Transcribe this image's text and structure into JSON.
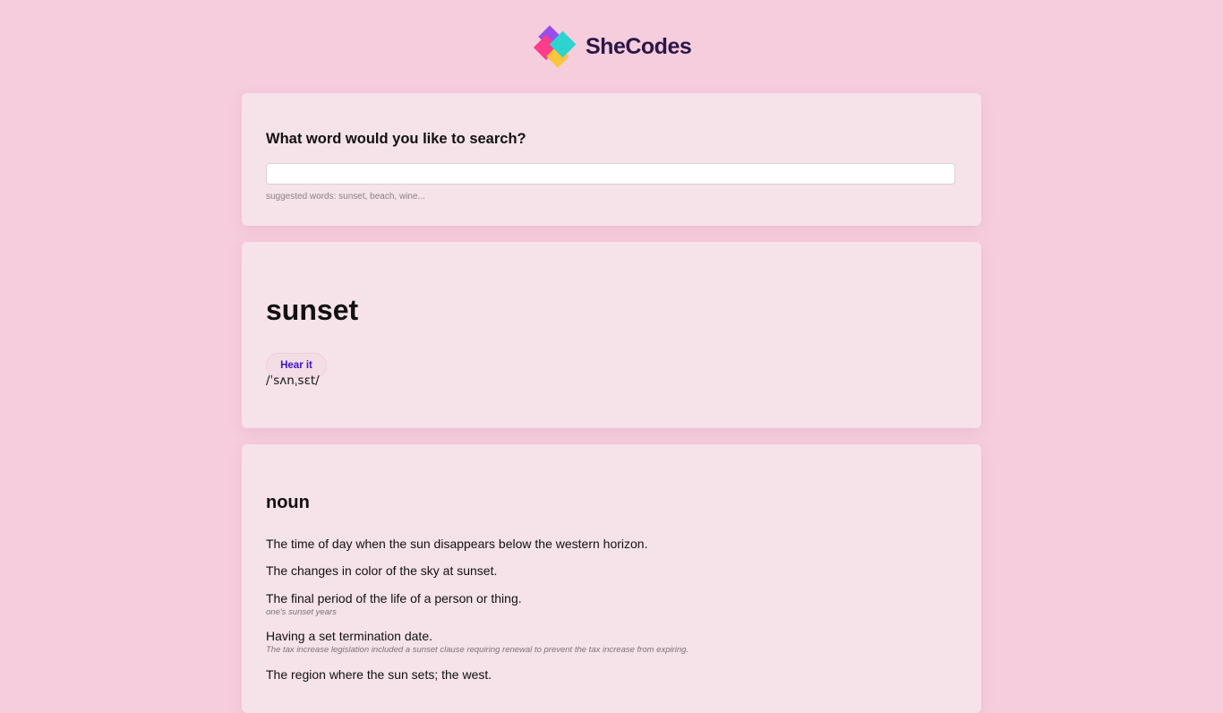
{
  "brand": {
    "name": "SheCodes",
    "logo_colors": [
      "#9b4dea",
      "#ff3d8b",
      "#2ed3d0",
      "#ffc53d"
    ]
  },
  "search": {
    "question": "What word would you like to search?",
    "input_value": "",
    "hint": "suggested words: sunset, beach, wine..."
  },
  "word": {
    "title": "sunset",
    "audio_button": "Hear it",
    "phonetic": "/ˈsʌnˌsɛt/"
  },
  "meaning": {
    "part_of_speech": "noun",
    "definitions": [
      {
        "text": "The time of day when the sun disappears below the western horizon.",
        "example": ""
      },
      {
        "text": "The changes in color of the sky at sunset.",
        "example": ""
      },
      {
        "text": "The final period of the life of a person or thing.",
        "example": "one's sunset years"
      },
      {
        "text": "Having a set termination date.",
        "example": "The tax increase legislation included a sunset clause requiring renewal to prevent the tax increase from expiring."
      },
      {
        "text": "The region where the sun sets; the west.",
        "example": ""
      }
    ]
  }
}
